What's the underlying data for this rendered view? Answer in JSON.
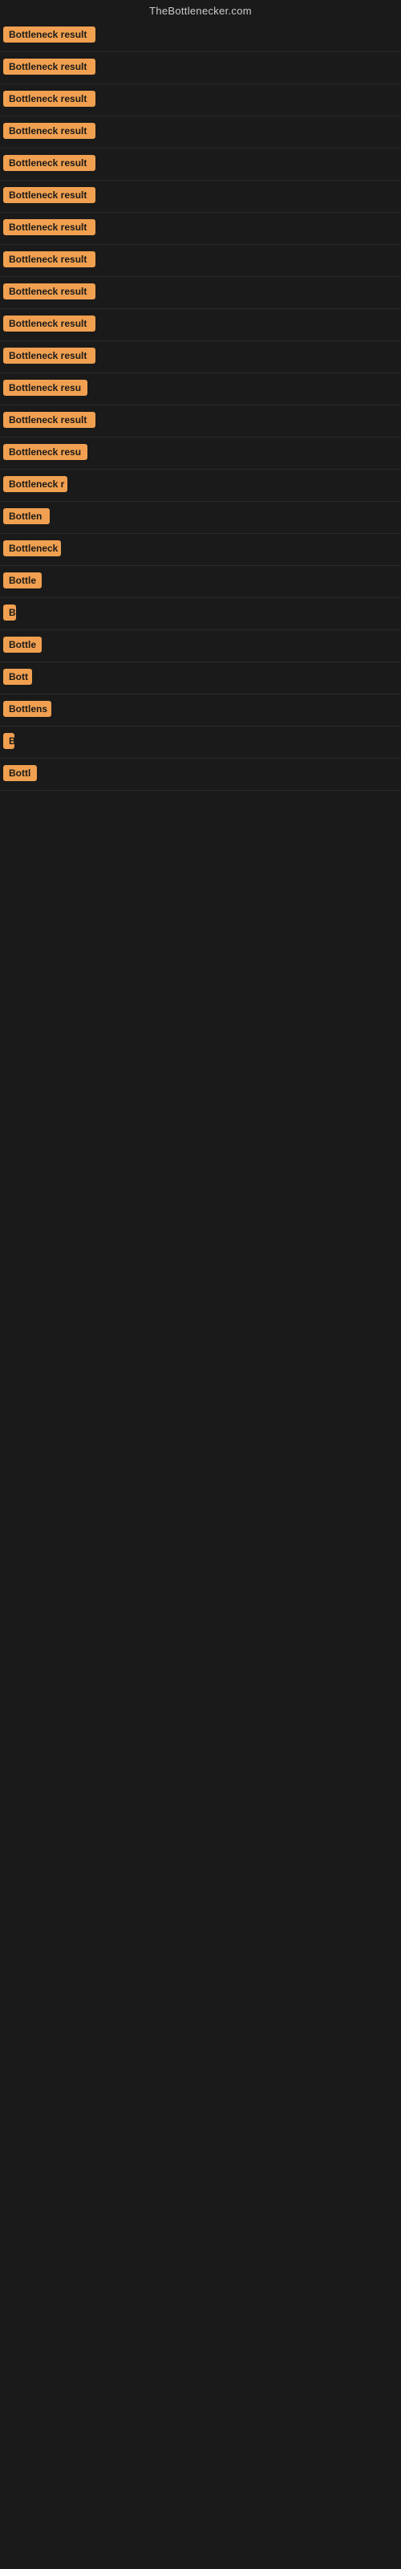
{
  "site": {
    "title": "TheBottlenecker.com"
  },
  "rows": [
    {
      "label": "Bottleneck result",
      "width": 115
    },
    {
      "label": "Bottleneck result",
      "width": 115
    },
    {
      "label": "Bottleneck result",
      "width": 115
    },
    {
      "label": "Bottleneck result",
      "width": 115
    },
    {
      "label": "Bottleneck result",
      "width": 115
    },
    {
      "label": "Bottleneck result",
      "width": 115
    },
    {
      "label": "Bottleneck result",
      "width": 115
    },
    {
      "label": "Bottleneck result",
      "width": 115
    },
    {
      "label": "Bottleneck result",
      "width": 115
    },
    {
      "label": "Bottleneck result",
      "width": 115
    },
    {
      "label": "Bottleneck result",
      "width": 115
    },
    {
      "label": "Bottleneck resu",
      "width": 105
    },
    {
      "label": "Bottleneck result",
      "width": 115
    },
    {
      "label": "Bottleneck resu",
      "width": 105
    },
    {
      "label": "Bottleneck r",
      "width": 80
    },
    {
      "label": "Bottlen",
      "width": 58
    },
    {
      "label": "Bottleneck",
      "width": 72
    },
    {
      "label": "Bottle",
      "width": 48
    },
    {
      "label": "B",
      "width": 16
    },
    {
      "label": "Bottle",
      "width": 48
    },
    {
      "label": "Bott",
      "width": 36
    },
    {
      "label": "Bottlens",
      "width": 60
    },
    {
      "label": "B",
      "width": 14
    },
    {
      "label": "Bottl",
      "width": 42
    }
  ]
}
